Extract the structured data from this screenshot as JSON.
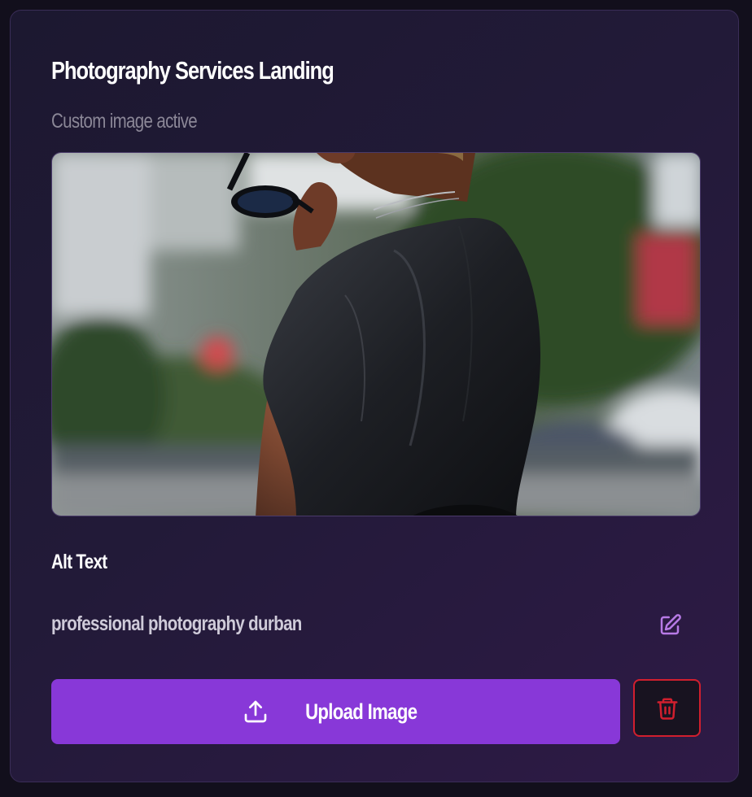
{
  "card": {
    "title": "Photography Services Landing",
    "status": "Custom image active"
  },
  "image": {
    "description_icon": "photo-preview"
  },
  "alt_text": {
    "label": "Alt Text",
    "value": "professional photography durban",
    "edit_icon": "edit-icon"
  },
  "actions": {
    "upload_label": "Upload Image",
    "upload_icon": "upload-icon",
    "delete_icon": "trash-icon"
  },
  "colors": {
    "accent": "#8838d8",
    "danger": "#d11f2e",
    "edit_icon": "#b77ae6"
  }
}
